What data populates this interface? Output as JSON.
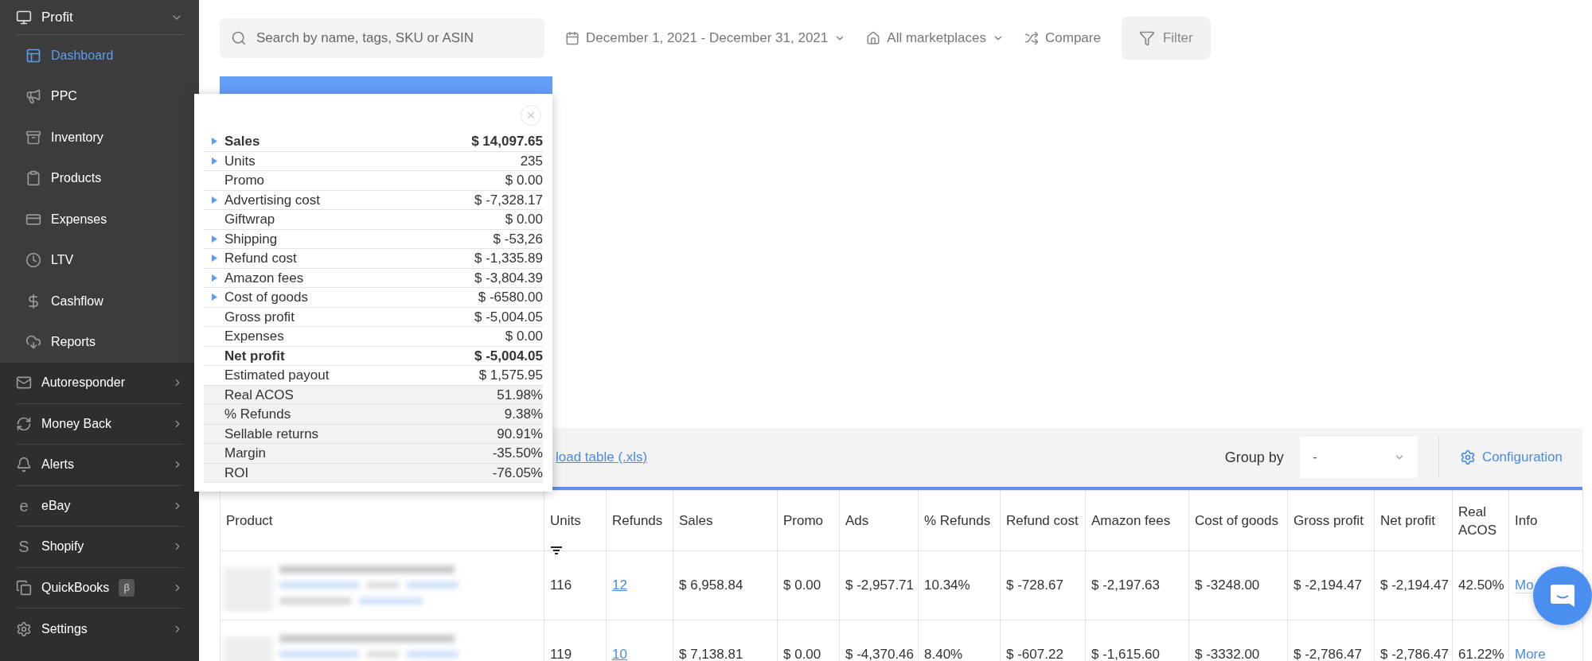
{
  "sidebar": {
    "section": {
      "label": "Profit",
      "expanded": true,
      "items": [
        {
          "label": "Dashboard",
          "selected": true
        },
        {
          "label": "PPC",
          "selected": false
        },
        {
          "label": "Inventory",
          "selected": false
        },
        {
          "label": "Products",
          "selected": false
        },
        {
          "label": "Expenses",
          "selected": false
        },
        {
          "label": "LTV",
          "selected": false
        },
        {
          "label": "Cashflow",
          "selected": false
        },
        {
          "label": "Reports",
          "selected": false
        }
      ]
    },
    "items": [
      {
        "label": "Autoresponder"
      },
      {
        "label": "Money Back"
      },
      {
        "label": "Alerts"
      },
      {
        "label": "eBay",
        "glyph": "e"
      },
      {
        "label": "Shopify",
        "glyph": "S"
      },
      {
        "label": "QuickBooks",
        "badge": "β"
      },
      {
        "label": "Settings"
      }
    ]
  },
  "toolbar": {
    "search": {
      "placeholder": "Search by name, tags, SKU or ASIN"
    },
    "date_range": "December 1, 2021 - December 31, 2021",
    "marketplace": "All marketplaces",
    "compare": "Compare",
    "filter": "Filter"
  },
  "summary_popup": {
    "rows": [
      {
        "label": "Sales",
        "value": "$ 14,097.65",
        "expandable": true,
        "bold": true,
        "kind": "amount"
      },
      {
        "label": "Units",
        "value": "235",
        "expandable": true,
        "bold": false,
        "kind": "amount"
      },
      {
        "label": "Promo",
        "value": "$ 0.00",
        "expandable": false,
        "bold": false,
        "kind": "amount"
      },
      {
        "label": "Advertising cost",
        "value": "$ -7,328.17",
        "expandable": true,
        "bold": false,
        "kind": "amount"
      },
      {
        "label": "Giftwrap",
        "value": "$ 0.00",
        "expandable": false,
        "bold": false,
        "kind": "amount"
      },
      {
        "label": "Shipping",
        "value": "$ -53,26",
        "expandable": true,
        "bold": false,
        "kind": "amount"
      },
      {
        "label": "Refund cost",
        "value": "$ -1,335.89",
        "expandable": true,
        "bold": false,
        "kind": "amount"
      },
      {
        "label": "Amazon fees",
        "value": "$ -3,804.39",
        "expandable": true,
        "bold": false,
        "kind": "amount"
      },
      {
        "label": "Cost of goods",
        "value": "$ -6580.00",
        "expandable": true,
        "bold": false,
        "kind": "amount"
      },
      {
        "label": "Gross profit",
        "value": "$ -5,004.05",
        "expandable": false,
        "bold": false,
        "kind": "amount"
      },
      {
        "label": "Expenses",
        "value": "$ 0.00",
        "expandable": false,
        "bold": false,
        "kind": "amount"
      },
      {
        "label": "Net profit",
        "value": "$ -5,004.05",
        "expandable": false,
        "bold": true,
        "kind": "amount"
      },
      {
        "label": "Estimated payout",
        "value": "$ 1,575.95",
        "expandable": false,
        "bold": false,
        "kind": "amount"
      },
      {
        "label": "Real ACOS",
        "value": "51.98%",
        "expandable": false,
        "bold": false,
        "kind": "ratio"
      },
      {
        "label": "% Refunds",
        "value": "9.38%",
        "expandable": false,
        "bold": false,
        "kind": "ratio"
      },
      {
        "label": "Sellable returns",
        "value": "90.91%",
        "expandable": false,
        "bold": false,
        "kind": "ratio"
      },
      {
        "label": "Margin",
        "value": "-35.50%",
        "expandable": false,
        "bold": false,
        "kind": "ratio"
      },
      {
        "label": "ROI",
        "value": "-76.05%",
        "expandable": false,
        "bold": false,
        "kind": "ratio"
      }
    ]
  },
  "table_toolbar": {
    "download_link": "load table (.xls)",
    "group_by_label": "Group by",
    "group_by_value": "-",
    "configuration": "Configuration"
  },
  "table": {
    "columns": [
      {
        "label": "Product",
        "sorted": false
      },
      {
        "label": "Units",
        "sorted": true
      },
      {
        "label": "Refunds",
        "sorted": false
      },
      {
        "label": "Sales",
        "sorted": false
      },
      {
        "label": "Promo",
        "sorted": false
      },
      {
        "label": "Ads",
        "sorted": false
      },
      {
        "label": "% Refunds",
        "sorted": false
      },
      {
        "label": "Refund cost",
        "sorted": false
      },
      {
        "label": "Amazon fees",
        "sorted": false
      },
      {
        "label": "Cost of goods",
        "sorted": false
      },
      {
        "label": "Gross profit",
        "sorted": false
      },
      {
        "label": "Net profit",
        "sorted": false
      },
      {
        "label": "Real ACOS",
        "sorted": false
      },
      {
        "label": "Info",
        "sorted": false
      }
    ],
    "rows": [
      {
        "units": "116",
        "refunds": "12",
        "sales": "$ 6,958.84",
        "promo": "$ 0.00",
        "ads": "$ -2,957.71",
        "pct_refunds": "10.34%",
        "refund_cost": "$ -728.67",
        "amazon_fees": "$ -2,197.63",
        "cost_of_goods": "$ -3248.00",
        "gross_profit": "$ -2,194.47",
        "net_profit": "$ -2,194.47",
        "real_acos": "42.50%",
        "info": "Mo"
      },
      {
        "units": "119",
        "refunds": "10",
        "sales": "$ 7,138.81",
        "promo": "$ 0.00",
        "ads": "$ -4,370.46",
        "pct_refunds": "8.40%",
        "refund_cost": "$ -607.22",
        "amazon_fees": "$ -1,615.60",
        "cost_of_goods": "$ -3332.00",
        "gross_profit": "$ -2,786.47",
        "net_profit": "$ -2,786.47",
        "real_acos": "61.22%",
        "info": "More"
      }
    ]
  }
}
